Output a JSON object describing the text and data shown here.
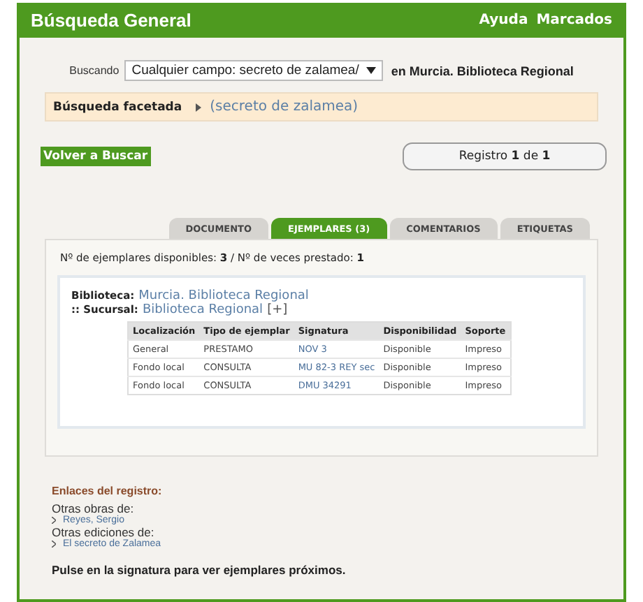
{
  "header": {
    "title": "Búsqueda General",
    "links": [
      "Ayuda",
      "Marcados"
    ]
  },
  "search": {
    "label": "Buscando",
    "value": "Cualquier campo: secreto de zalamea/",
    "scope": "en Murcia. Biblioteca Regional"
  },
  "facets": {
    "label": "Búsqueda facetada",
    "term": "(secreto de zalamea)"
  },
  "back_button": "Volver a Buscar",
  "record_counter": "Registro **1** de **1**",
  "tabs": [
    {
      "label": "DOCUMENTO",
      "selected": false
    },
    {
      "label": "EJEMPLARES (3)",
      "selected": true
    },
    {
      "label": "COMENTARIOS",
      "selected": false
    },
    {
      "label": "ETIQUETAS",
      "selected": false
    }
  ],
  "summary": "Nº de ejemplares disponibles: **3**  /  Nº de veces prestado: **1**",
  "library": {
    "label": "Biblioteca:",
    "value": "Murcia. Biblioteca Regional"
  },
  "branch": {
    "label": ":: Sucursal:",
    "value": "Biblioteca Regional",
    "expand": "[+]"
  },
  "table": {
    "columns": [
      "Localización",
      "Tipo de ejemplar",
      "Signatura",
      "Disponibilidad",
      "Soporte"
    ],
    "rows": [
      [
        "General",
        "PRESTAMO",
        "NOV 3",
        "Disponible",
        "Impreso"
      ],
      [
        "Fondo local",
        "CONSULTA",
        "MU 82-3 REY sec",
        "Disponible",
        "Impreso"
      ],
      [
        "Fondo local",
        "CONSULTA",
        "DMU 34291",
        "Disponible",
        "Impreso"
      ]
    ]
  },
  "record_links": {
    "title": "Enlaces del registro:",
    "groups": [
      {
        "heading": "Otras obras de:",
        "link": "Reyes, Sergio"
      },
      {
        "heading": "Otras ediciones de:",
        "link": "El secreto de Zalamea"
      }
    ]
  },
  "footer_note": "Pulse en la signatura para ver ejemplares próximos."
}
